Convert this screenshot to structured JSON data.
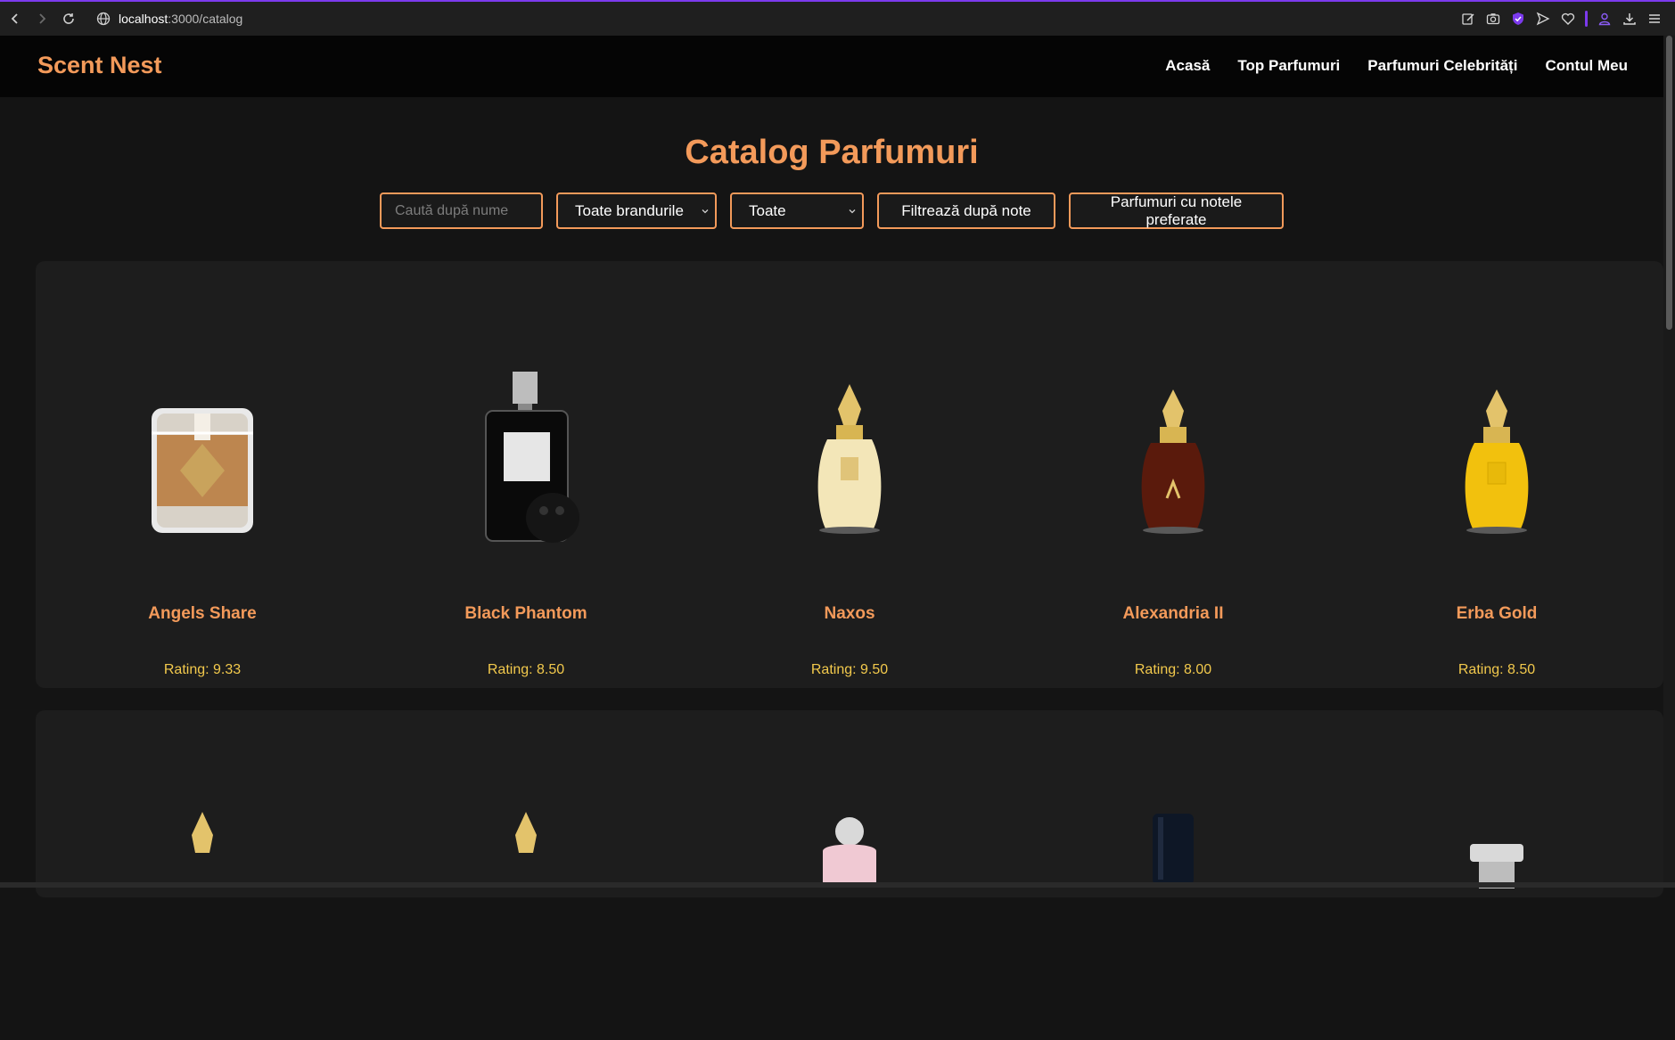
{
  "browser": {
    "url_host": "localhost",
    "url_path": ":3000/catalog"
  },
  "header": {
    "logo": "Scent Nest",
    "nav": [
      "Acasă",
      "Top Parfumuri",
      "Parfumuri Celebrități",
      "Contul Meu"
    ]
  },
  "main": {
    "title": "Catalog Parfumuri",
    "filters": {
      "search_placeholder": "Caută după nume",
      "brand_select": "Toate brandurile",
      "type_select": "Toate",
      "notes_button": "Filtrează după note",
      "preferred_button": "Parfumuri cu notele preferate"
    },
    "products": [
      {
        "name": "Angels Share",
        "rating": "Rating: 9.33"
      },
      {
        "name": "Black Phantom",
        "rating": "Rating: 8.50"
      },
      {
        "name": "Naxos",
        "rating": "Rating: 9.50"
      },
      {
        "name": "Alexandria II",
        "rating": "Rating: 8.00"
      },
      {
        "name": "Erba Gold",
        "rating": "Rating: 8.50"
      }
    ]
  },
  "colors": {
    "accent": "#f39a5a",
    "rating": "#f2c94c",
    "background": "#141414",
    "card": "#1d1d1d"
  }
}
